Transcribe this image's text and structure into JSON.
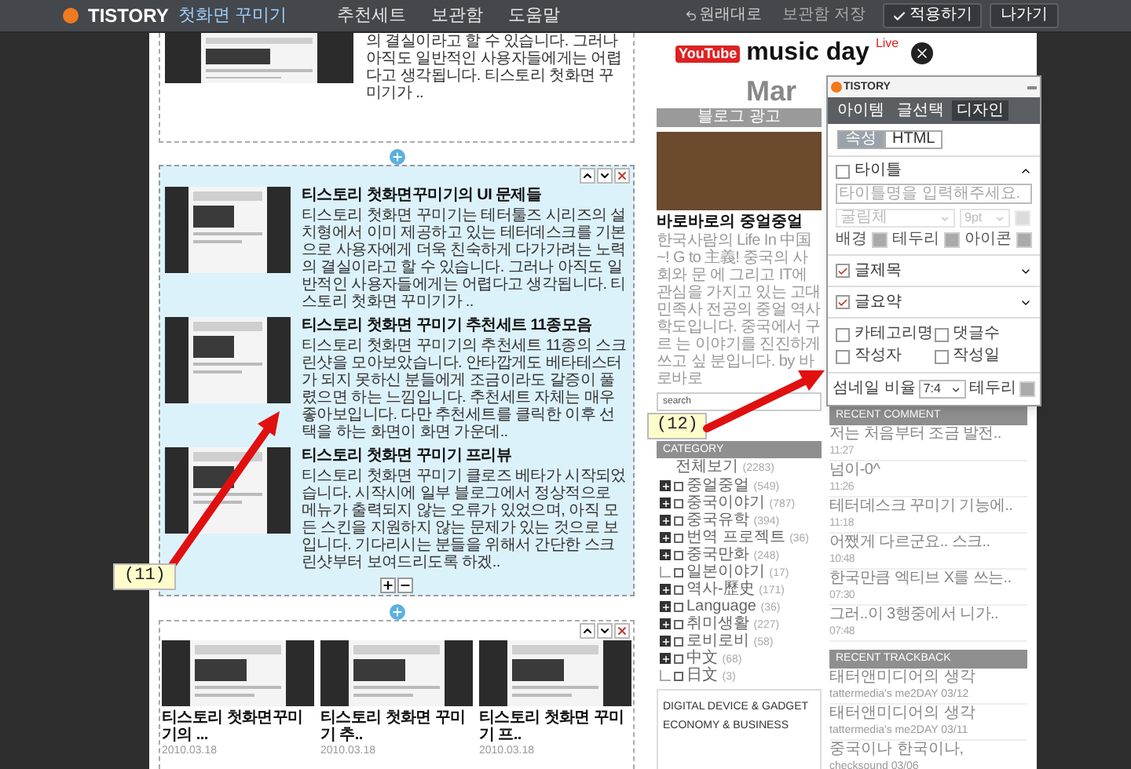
{
  "topbar": {
    "logo": "TISTORY",
    "title": "첫화면 꾸미기",
    "nav": [
      {
        "label": "추천세트"
      },
      {
        "label": "보관함"
      },
      {
        "label": "도움말"
      }
    ],
    "actions": [
      {
        "kind": "undo",
        "label": "원래대로"
      },
      {
        "kind": "link",
        "label": "보관함 저장"
      },
      {
        "kind": "apply",
        "label": "적용하기"
      },
      {
        "kind": "button",
        "label": "나가기"
      }
    ]
  },
  "top_module": {
    "text": "의 결실이라고 할 수 있습니다. 그러나 아직도 일반적인 사용자들에게는 어렵다고 생각됩니다. 티스토리 첫화면 꾸미기가 .."
  },
  "post_list_module": {
    "posts": [
      {
        "title": "티스토리 첫화면꾸미기의 UI 문제들",
        "summary": "티스토리 첫화면 꾸미기는 테터툴즈 시리즈의 설치형에서 이미 제공하고 있는 테터데스크를 기본으로 사용자에게 더욱 친숙하게 다가가려는 노력의 결실이라고 할 수 있습니다. 그러나 아직도 일반적인 사용자들에게는 어렵다고 생각됩니다. 티스토리 첫화면 꾸미기가 .."
      },
      {
        "title": "티스토리 첫화면 꾸미기 추천세트 11종모음",
        "summary": "티스토리 첫화면 꾸미기의 추천세트 11종의 스크린샷을 모아보았습니다. 안타깝게도 베타테스터가 되지 못하신 분들에게 조금이라도 갈증이 풀렸으면 하는 느낌입니다. 추천세트 자체는 매우 좋아보입니다. 다만 추천세트를 클릭한 이후 선택을 하는 화면이 화면 가운데.."
      },
      {
        "title": "티스토리 첫화면 꾸미기 프리뷰",
        "summary": "티스토리 첫화면 꾸미기 클로즈 베타가 시작되었습니다. 시작시에 일부 블로그에서 정상적으로 메뉴가 출력되지 않는 오류가 있었으며, 아직 모든 스킨을 지원하지 않는 문제가 있는 것으로 보입니다. 기다리시는 분들을 위해서 간단한 스크린샷부터 보여드리도록 하겠.."
      }
    ]
  },
  "gallery_module": {
    "posts": [
      {
        "title": "티스토리 첫화면꾸미기의 ...",
        "date": "2010.03.18"
      },
      {
        "title": "티스토리 첫화면 꾸미기 추..",
        "date": "2010.03.18"
      },
      {
        "title": "티스토리 첫화면 꾸미기 프..",
        "date": "2010.03.18"
      }
    ]
  },
  "sidebar": {
    "banner": {
      "brand": "YouTube",
      "title": "music day",
      "badge": "Live",
      "subtitle": "Mar"
    },
    "ad_bar": "블로그 광고",
    "blog_title": "바로바로의 중얼중얼",
    "description": "한국사람의 Life In 中国~! G to 主義! 중국의 사회와 문 에 그리고 IT에 관심을 가지고 있는 고대민족사 전공의 중얼 역사학도입니다. 중국에서 구르 는 이야기를 진진하게 쓰고 싶 분입니다. by 바로바로",
    "search": {
      "value": "search"
    },
    "category": {
      "heading": "CATEGORY",
      "root": {
        "name": "전체보기",
        "count": "(2283)",
        "children": [
          {
            "name": "중얼중얼",
            "count": "(549)",
            "collapsed": true
          },
          {
            "name": "중국이야기",
            "count": "(787)",
            "collapsed": true
          },
          {
            "name": "중국유학",
            "count": "(394)",
            "collapsed": true
          },
          {
            "name": "번역 프로젝트",
            "count": "(36)",
            "collapsed": true
          },
          {
            "name": "중국만화",
            "count": "(248)",
            "collapsed": true
          },
          {
            "name": "일본이야기",
            "count": "(17)",
            "collapsed": false
          },
          {
            "name": "역사-歷史",
            "count": "(171)",
            "collapsed": true
          },
          {
            "name": "Language",
            "count": "(36)",
            "collapsed": true
          },
          {
            "name": "취미생활",
            "count": "(227)",
            "collapsed": true
          },
          {
            "name": "로비로비",
            "count": "(58)",
            "collapsed": true
          },
          {
            "name": "中文",
            "count": "(68)",
            "collapsed": true
          },
          {
            "name": "日文",
            "count": "(3)",
            "collapsed": false
          }
        ]
      }
    },
    "links": [
      "DIGITAL DEVICE & GADGET",
      "ECONOMY & BUSINESS"
    ]
  },
  "recent_comments": {
    "heading": "RECENT COMMENT",
    "items": [
      {
        "text": "저는 처음부터 조금 발전..",
        "time": "11:27"
      },
      {
        "text": "넘이-0^",
        "time": "11:26"
      },
      {
        "text": "테터데스크 꾸미기 기능에..",
        "time": "11:18"
      },
      {
        "text": "어쨌게 다르군요.. 스크..",
        "time": "10:48"
      },
      {
        "text": "한국만큼 엑티브 X를 쓰는..",
        "time": "07:30"
      },
      {
        "text": "그러..이 3행중에서 니가..",
        "time": "07:48"
      }
    ]
  },
  "recent_trackbacks": {
    "heading": "RECENT TRACKBACK",
    "items": [
      {
        "title": "태터앤미디어의 생각",
        "source": "tattermedia's me2DAY",
        "date": "03/12"
      },
      {
        "title": "태터앤미디어의 생각",
        "source": "tattermedia's me2DAY",
        "date": "03/11"
      },
      {
        "title": "중국이나 한국이나,",
        "source": "checksound",
        "date": "03/06"
      }
    ]
  },
  "panel": {
    "logo": "TISTORY",
    "tabs": [
      {
        "label": "아이템",
        "selected": false
      },
      {
        "label": "글선택",
        "selected": false
      },
      {
        "label": "디자인",
        "selected": true
      }
    ],
    "modes": [
      {
        "label": "속성",
        "selected": true
      },
      {
        "label": "HTML",
        "selected": false
      }
    ],
    "sections": [
      {
        "kind": "title",
        "label": "타이틀",
        "checked": false,
        "expanded": true,
        "placeholder": "타이틀명을 입력해주세요.",
        "font": "굴림체",
        "size": "9pt",
        "disabled": true,
        "colors": [
          "배경",
          "테두리",
          "아이콘"
        ]
      },
      {
        "kind": "toggle",
        "label": "글제목",
        "checked": true,
        "expanded": false
      },
      {
        "kind": "toggle",
        "label": "글요약",
        "checked": true,
        "expanded": false
      },
      {
        "kind": "checks",
        "options": [
          {
            "label": "카테고리명",
            "checked": false
          },
          {
            "label": "댓글수",
            "checked": false
          },
          {
            "label": "작성자",
            "checked": false
          },
          {
            "label": "작성일",
            "checked": false
          }
        ]
      },
      {
        "kind": "thumb",
        "label": "섬네일 비율",
        "value": "7:4",
        "border_label": "테두리"
      }
    ]
  },
  "annotations": [
    {
      "label": "(11)"
    },
    {
      "label": "(12)"
    }
  ]
}
